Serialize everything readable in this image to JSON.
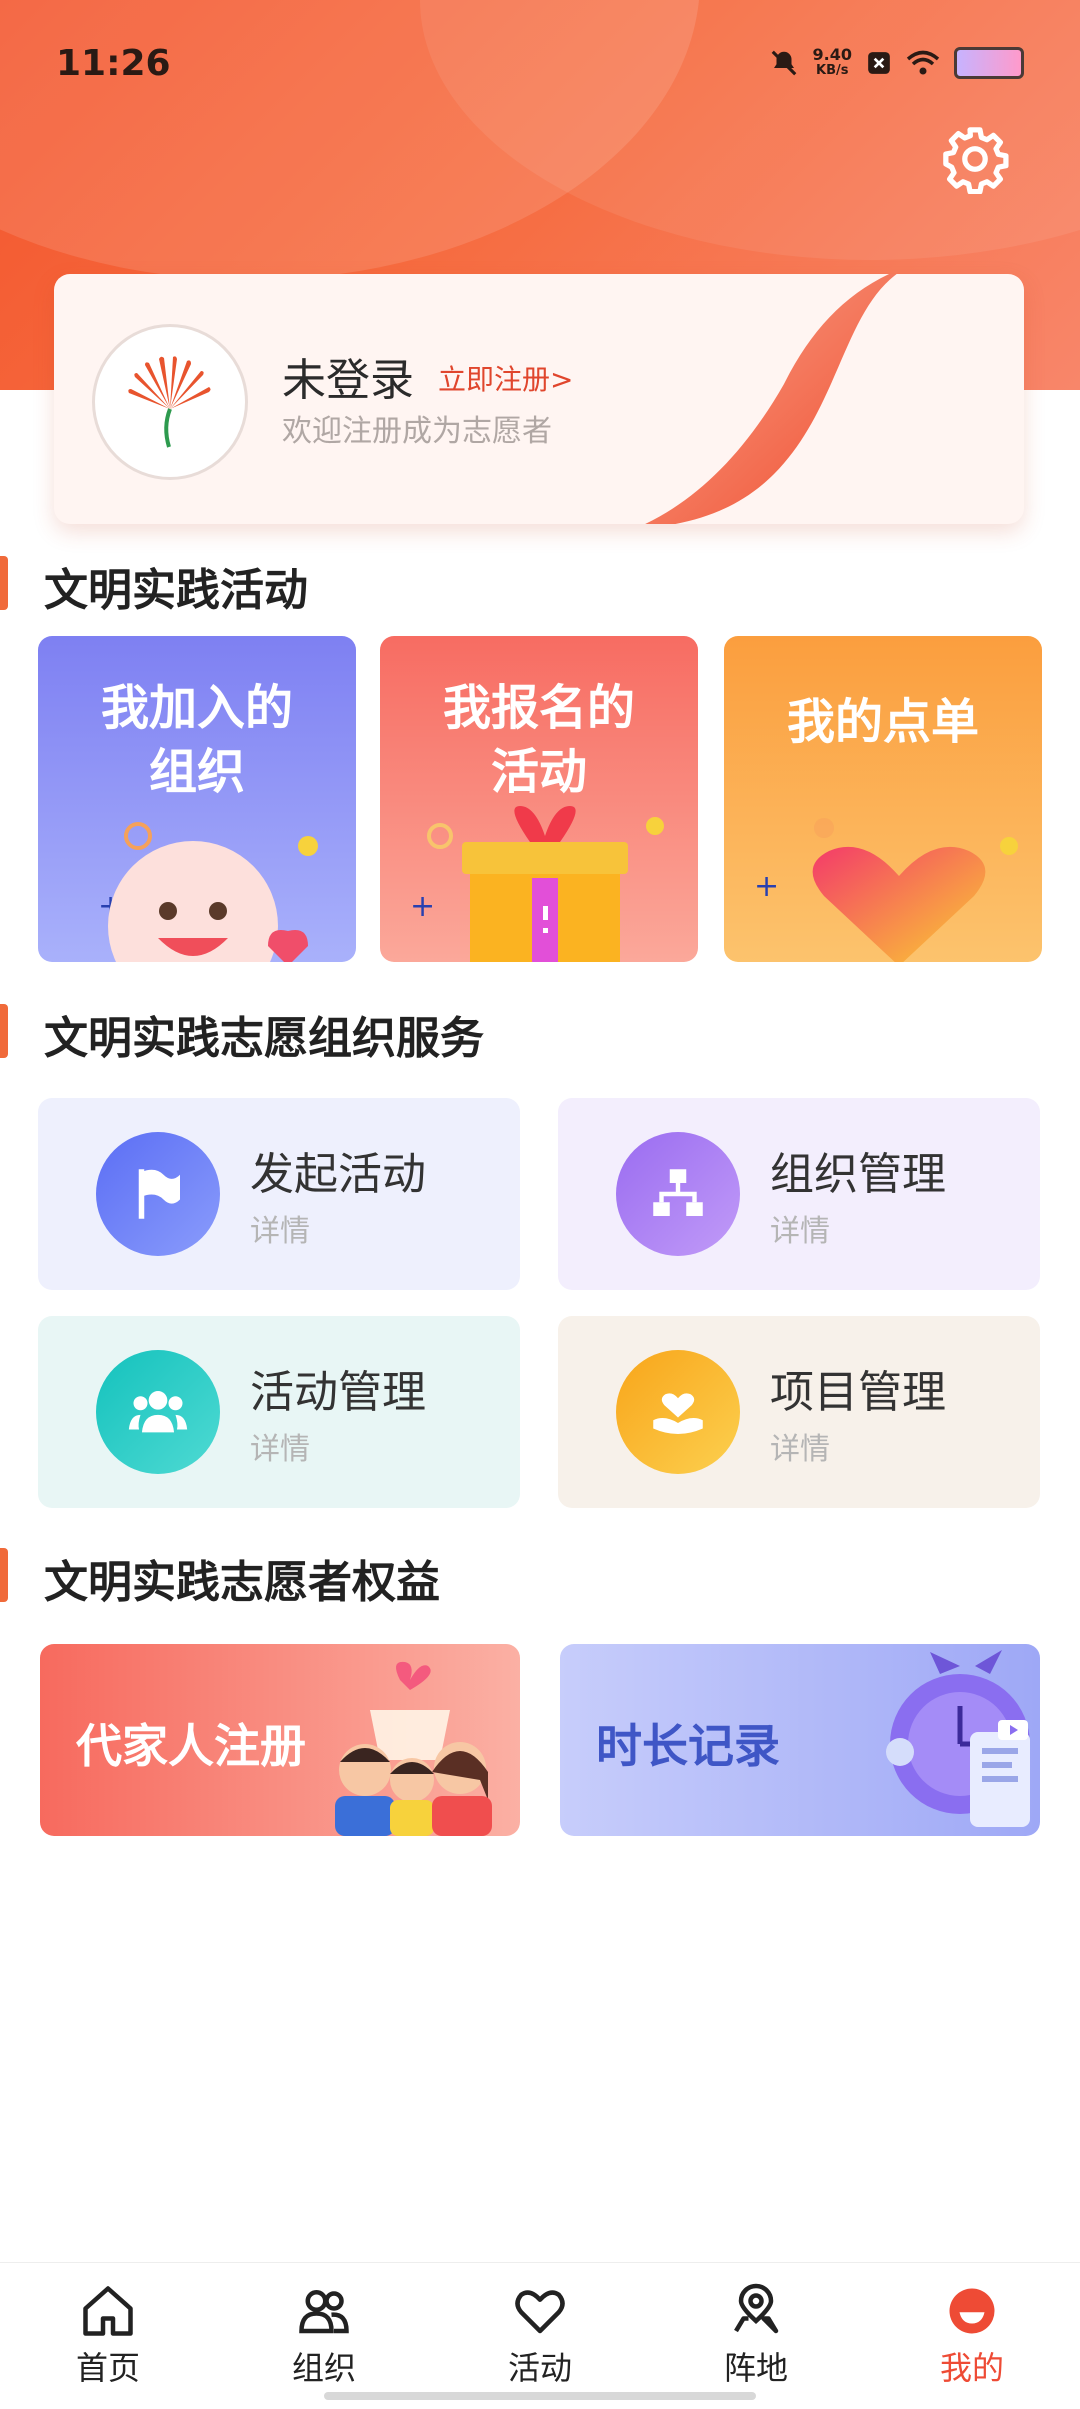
{
  "status": {
    "time": "11:26",
    "speed_value": "9.40",
    "speed_unit": "KB/s"
  },
  "profile": {
    "name": "未登录",
    "register_link": "立即注册>",
    "welcome": "欢迎注册成为志愿者"
  },
  "sections": {
    "activities": "文明实践活动",
    "org_services": "文明实践志愿组织服务",
    "benefits": "文明实践志愿者权益"
  },
  "activity_cards": [
    {
      "label_line1": "我加入的",
      "label_line2": "组织",
      "color": "#8c8df5"
    },
    {
      "label_line1": "我报名的",
      "label_line2": "活动",
      "color": "#f77b6e"
    },
    {
      "label_line1": "我的点单",
      "label_line2": "",
      "color": "#fbab4e"
    }
  ],
  "service_cards": [
    {
      "title": "发起活动",
      "sub": "详情",
      "icon": "flag-icon",
      "icon_color": "#6c7ef7",
      "bg": "#eef0fd"
    },
    {
      "title": "组织管理",
      "sub": "详情",
      "icon": "org-chart-icon",
      "icon_color": "#a77ef2",
      "bg": "#f3eefd"
    },
    {
      "title": "活动管理",
      "sub": "详情",
      "icon": "group-icon",
      "icon_color": "#29c9c4",
      "bg": "#e8f6f5"
    },
    {
      "title": "项目管理",
      "sub": "详情",
      "icon": "heart-hand-icon",
      "icon_color": "#f9b224",
      "bg": "#f7f1ea"
    }
  ],
  "benefits": [
    {
      "label": "代家人注册",
      "color": "#ffffff"
    },
    {
      "label": "时长记录",
      "color": "#3f56c6"
    }
  ],
  "tabs": [
    {
      "label": "首页",
      "icon": "home-icon"
    },
    {
      "label": "组织",
      "icon": "people-icon"
    },
    {
      "label": "活动",
      "icon": "heart-icon"
    },
    {
      "label": "阵地",
      "icon": "location-icon"
    },
    {
      "label": "我的",
      "icon": "profile-icon",
      "active": true
    }
  ],
  "colors": {
    "brand": "#f3552d",
    "active_tab": "#ee4b35"
  }
}
